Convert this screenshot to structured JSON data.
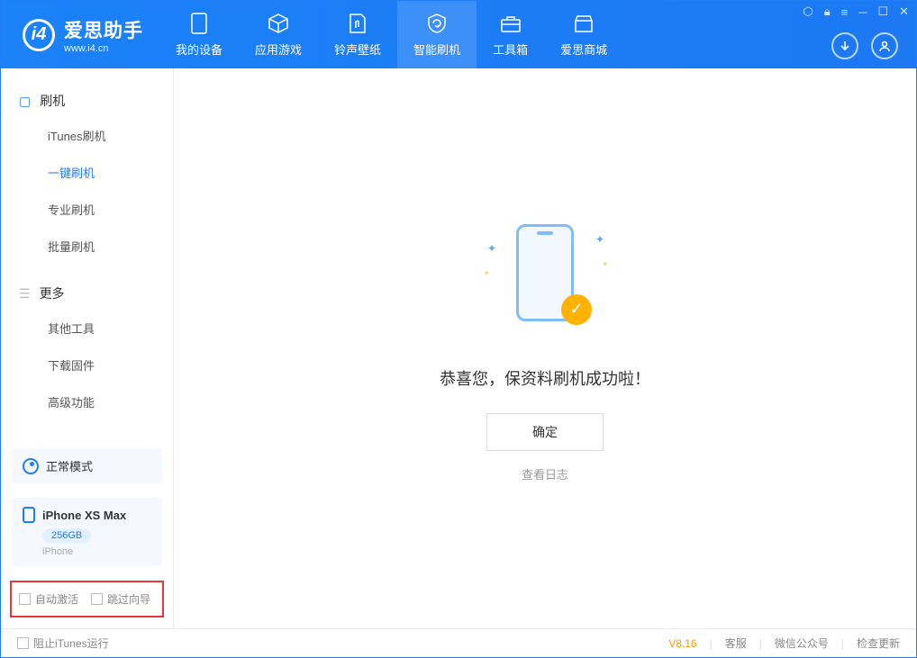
{
  "app": {
    "title": "爱思助手",
    "subtitle": "www.i4.cn"
  },
  "tabs": {
    "device": "我的设备",
    "apps": "应用游戏",
    "ringtone": "铃声壁纸",
    "flash": "智能刷机",
    "toolbox": "工具箱",
    "store": "爱思商城"
  },
  "sidebar": {
    "section_flash": "刷机",
    "items_flash": {
      "itunes": "iTunes刷机",
      "onekey": "一键刷机",
      "pro": "专业刷机",
      "batch": "批量刷机"
    },
    "section_more": "更多",
    "items_more": {
      "other": "其他工具",
      "firmware": "下载固件",
      "advanced": "高级功能"
    }
  },
  "device": {
    "mode": "正常模式",
    "name": "iPhone XS Max",
    "capacity": "256GB",
    "type": "iPhone"
  },
  "options": {
    "auto_activate": "自动激活",
    "skip_guide": "跳过向导"
  },
  "main": {
    "success_text": "恭喜您，保资料刷机成功啦！",
    "confirm": "确定",
    "view_log": "查看日志"
  },
  "footer": {
    "block_itunes": "阻止iTunes运行",
    "version": "V8.16",
    "support": "客服",
    "wechat": "微信公众号",
    "update": "检查更新"
  }
}
